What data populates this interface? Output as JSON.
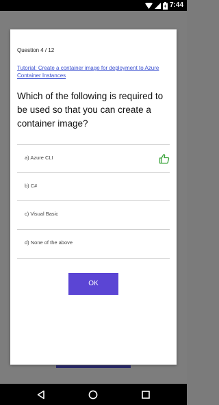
{
  "status_bar": {
    "time": "7:44",
    "icons": [
      "wifi-icon",
      "signal-icon",
      "battery-icon"
    ]
  },
  "dialog": {
    "question_counter": "Question 4 / 12",
    "tutorial_link": "Tutorial: Create a container image for deployment to Azure Container Instances",
    "question": "Which of the following is required to be used so that you can create a container image?",
    "options": [
      {
        "label": "a) Azure CLI",
        "correct": true
      },
      {
        "label": "b) C#",
        "correct": false
      },
      {
        "label": "c) Visual Basic",
        "correct": false
      },
      {
        "label": "d) None of the above",
        "correct": false
      }
    ],
    "ok_label": "OK"
  },
  "nav_bar": {
    "buttons": [
      "back-icon",
      "home-icon",
      "recents-icon"
    ]
  },
  "colors": {
    "accent": "#5b45d4",
    "link": "#3a4fd0",
    "correct": "#3aa33a",
    "status_bar": "#000000",
    "scrim": "#7d7d7d"
  }
}
